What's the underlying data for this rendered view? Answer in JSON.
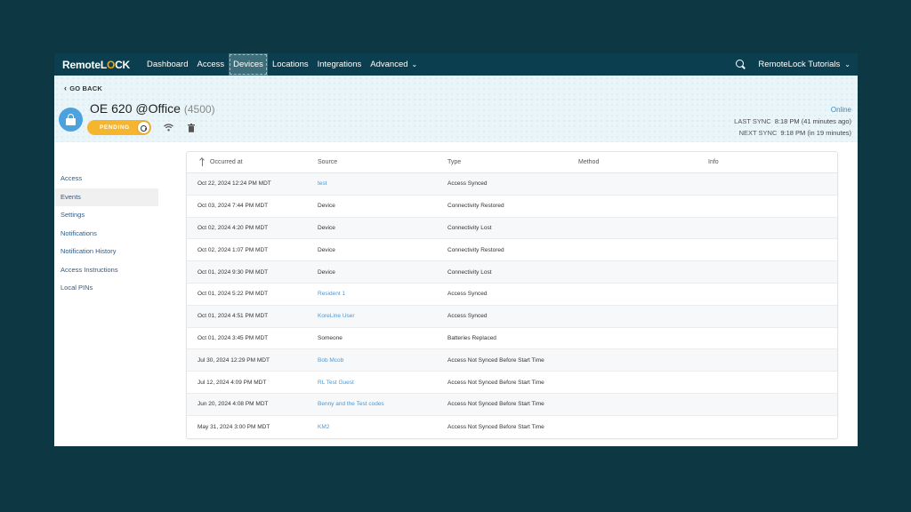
{
  "brand": {
    "name_part1": "Remote",
    "name_part2": "L",
    "name_o": "O",
    "name_part3": "CK"
  },
  "nav": {
    "items": [
      {
        "label": "Dashboard"
      },
      {
        "label": "Access"
      },
      {
        "label": "Devices"
      },
      {
        "label": "Locations"
      },
      {
        "label": "Integrations"
      },
      {
        "label": "Advanced"
      }
    ],
    "active": "Devices",
    "account": "RemoteLock Tutorials"
  },
  "header": {
    "back_label": "GO BACK",
    "device_name": "OE 620 @Office",
    "device_id": "(4500)",
    "status_badge": "PENDING",
    "connection_status": "Online",
    "last_sync_label": "LAST SYNC",
    "last_sync_value": "8:18 PM (41 minutes ago)",
    "next_sync_label": "NEXT SYNC",
    "next_sync_value": "9:18 PM (in 19 minutes)"
  },
  "sidebar": {
    "items": [
      {
        "label": "Access"
      },
      {
        "label": "Events"
      },
      {
        "label": "Settings"
      },
      {
        "label": "Notifications"
      },
      {
        "label": "Notification History"
      },
      {
        "label": "Access Instructions"
      },
      {
        "label": "Local PINs"
      }
    ],
    "active": "Events"
  },
  "table": {
    "columns": [
      "Occurred at",
      "Source",
      "Type",
      "Method",
      "Info"
    ],
    "rows": [
      {
        "occurred": "Oct 22, 2024 12:24 PM MDT",
        "source": "test",
        "source_link": true,
        "type": "Access Synced",
        "method": "",
        "info": ""
      },
      {
        "occurred": "Oct 03, 2024 7:44 PM MDT",
        "source": "Device",
        "source_link": false,
        "type": "Connectivity Restored",
        "method": "",
        "info": ""
      },
      {
        "occurred": "Oct 02, 2024 4:20 PM MDT",
        "source": "Device",
        "source_link": false,
        "type": "Connectivity Lost",
        "method": "",
        "info": ""
      },
      {
        "occurred": "Oct 02, 2024 1:07 PM MDT",
        "source": "Device",
        "source_link": false,
        "type": "Connectivity Restored",
        "method": "",
        "info": ""
      },
      {
        "occurred": "Oct 01, 2024 9:30 PM MDT",
        "source": "Device",
        "source_link": false,
        "type": "Connectivity Lost",
        "method": "",
        "info": ""
      },
      {
        "occurred": "Oct 01, 2024 5:22 PM MDT",
        "source": "Resident 1",
        "source_link": true,
        "type": "Access Synced",
        "method": "",
        "info": ""
      },
      {
        "occurred": "Oct 01, 2024 4:51 PM MDT",
        "source": "KoreLine User",
        "source_link": true,
        "type": "Access Synced",
        "method": "",
        "info": ""
      },
      {
        "occurred": "Oct 01, 2024 3:45 PM MDT",
        "source": "Someone",
        "source_link": false,
        "type": "Batteries Replaced",
        "method": "",
        "info": ""
      },
      {
        "occurred": "Jul 30, 2024 12:29 PM MDT",
        "source": "Bob Mcob",
        "source_link": true,
        "type": "Access Not Synced Before Start Time",
        "method": "",
        "info": ""
      },
      {
        "occurred": "Jul 12, 2024 4:09 PM MDT",
        "source": "RL Test Guest",
        "source_link": true,
        "type": "Access Not Synced Before Start Time",
        "method": "",
        "info": ""
      },
      {
        "occurred": "Jun 20, 2024 4:08 PM MDT",
        "source": "Benny and the Test codes",
        "source_link": true,
        "type": "Access Not Synced Before Start Time",
        "method": "",
        "info": ""
      },
      {
        "occurred": "May 31, 2024 3:00 PM MDT",
        "source": "KM2",
        "source_link": true,
        "type": "Access Not Synced Before Start Time",
        "method": "",
        "info": ""
      }
    ]
  },
  "colors": {
    "background": "#0d3743",
    "topnav": "#0b3f4f",
    "accent_link": "#4a9ad6",
    "pending": "#f5b52e",
    "lock_badge": "#4aa3df"
  },
  "icons": [
    "search-icon",
    "chevron-down-icon",
    "chevron-left-icon",
    "lock-icon",
    "pending-lock-icon",
    "wifi-icon",
    "trash-icon",
    "sort-icon"
  ]
}
